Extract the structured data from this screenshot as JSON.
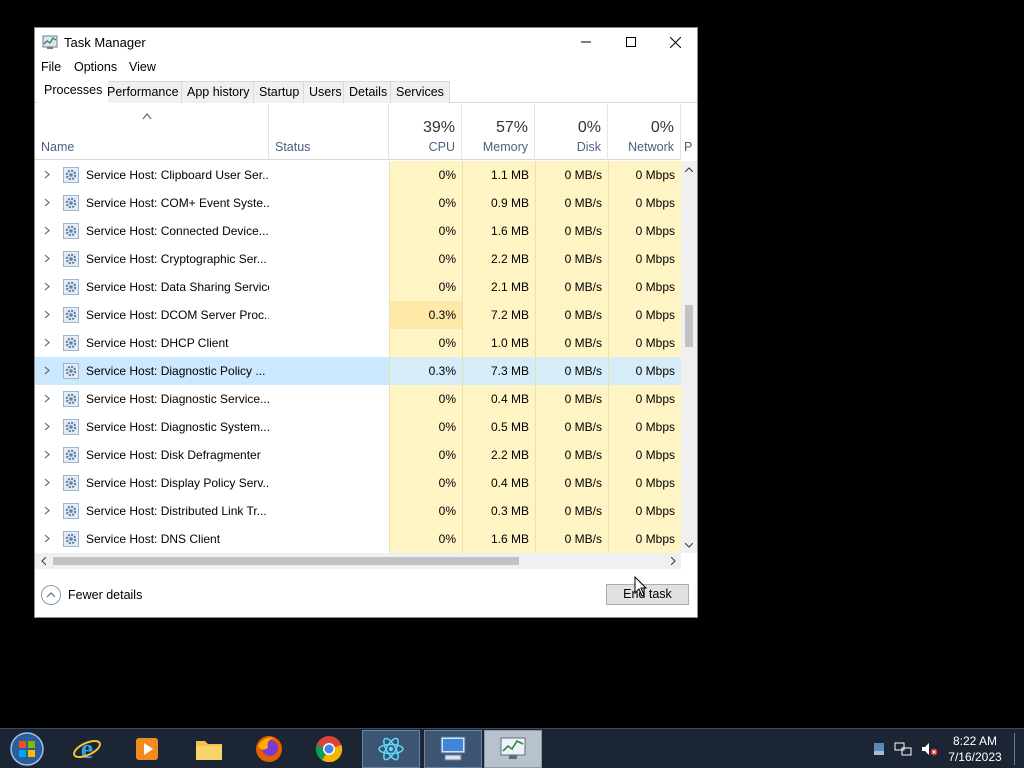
{
  "window": {
    "title": "Task Manager",
    "controls": {
      "minimize": "minimize",
      "maximize": "maximize",
      "close": "close"
    }
  },
  "menu": [
    "File",
    "Options",
    "View"
  ],
  "tabs": [
    "Processes",
    "Performance",
    "App history",
    "Startup",
    "Users",
    "Details",
    "Services"
  ],
  "active_tab": "Processes",
  "columns": {
    "name": "Name",
    "status": "Status",
    "cpu": {
      "pct": "39%",
      "label": "CPU"
    },
    "memory": {
      "pct": "57%",
      "label": "Memory"
    },
    "disk": {
      "pct": "0%",
      "label": "Disk"
    },
    "network": {
      "pct": "0%",
      "label": "Network"
    },
    "overflow": "P"
  },
  "processes": [
    {
      "name": "Service Host: Clipboard User Ser...",
      "status": "",
      "cpu": "0%",
      "memory": "1.1 MB",
      "disk": "0 MB/s",
      "network": "0 Mbps"
    },
    {
      "name": "Service Host: COM+ Event Syste...",
      "status": "",
      "cpu": "0%",
      "memory": "0.9 MB",
      "disk": "0 MB/s",
      "network": "0 Mbps"
    },
    {
      "name": "Service Host: Connected Device...",
      "status": "",
      "cpu": "0%",
      "memory": "1.6 MB",
      "disk": "0 MB/s",
      "network": "0 Mbps"
    },
    {
      "name": "Service Host: Cryptographic Ser...",
      "status": "",
      "cpu": "0%",
      "memory": "2.2 MB",
      "disk": "0 MB/s",
      "network": "0 Mbps"
    },
    {
      "name": "Service Host: Data Sharing Service",
      "status": "",
      "cpu": "0%",
      "memory": "2.1 MB",
      "disk": "0 MB/s",
      "network": "0 Mbps"
    },
    {
      "name": "Service Host: DCOM Server Proc...",
      "status": "",
      "cpu": "0.3%",
      "memory": "7.2 MB",
      "disk": "0 MB/s",
      "network": "0 Mbps"
    },
    {
      "name": "Service Host: DHCP Client",
      "status": "",
      "cpu": "0%",
      "memory": "1.0 MB",
      "disk": "0 MB/s",
      "network": "0 Mbps"
    },
    {
      "name": "Service Host: Diagnostic Policy ...",
      "status": "",
      "cpu": "0.3%",
      "memory": "7.3 MB",
      "disk": "0 MB/s",
      "network": "0 Mbps",
      "selected": true
    },
    {
      "name": "Service Host: Diagnostic Service...",
      "status": "",
      "cpu": "0%",
      "memory": "0.4 MB",
      "disk": "0 MB/s",
      "network": "0 Mbps"
    },
    {
      "name": "Service Host: Diagnostic System...",
      "status": "",
      "cpu": "0%",
      "memory": "0.5 MB",
      "disk": "0 MB/s",
      "network": "0 Mbps"
    },
    {
      "name": "Service Host: Disk Defragmenter",
      "status": "",
      "cpu": "0%",
      "memory": "2.2 MB",
      "disk": "0 MB/s",
      "network": "0 Mbps"
    },
    {
      "name": "Service Host: Display Policy Serv...",
      "status": "",
      "cpu": "0%",
      "memory": "0.4 MB",
      "disk": "0 MB/s",
      "network": "0 Mbps"
    },
    {
      "name": "Service Host: Distributed Link Tr...",
      "status": "",
      "cpu": "0%",
      "memory": "0.3 MB",
      "disk": "0 MB/s",
      "network": "0 Mbps"
    },
    {
      "name": "Service Host: DNS Client",
      "status": "",
      "cpu": "0%",
      "memory": "1.6 MB",
      "disk": "0 MB/s",
      "network": "0 Mbps"
    }
  ],
  "footer": {
    "fewer_details": "Fewer details",
    "end_task": "End task"
  },
  "taskbar": {
    "apps": [
      "start-orb",
      "internet-explorer",
      "media-player",
      "file-explorer",
      "firefox",
      "chrome",
      "react-devtools",
      "remote-desktop",
      "task-manager"
    ],
    "clock_time": "8:22 AM",
    "clock_date": "7/16/2023"
  },
  "colors": {
    "heat_low": "#fff4c4",
    "heat_mid": "#ffe9a8",
    "selection": "#cce8ff",
    "taskbar": "#1b2533"
  }
}
